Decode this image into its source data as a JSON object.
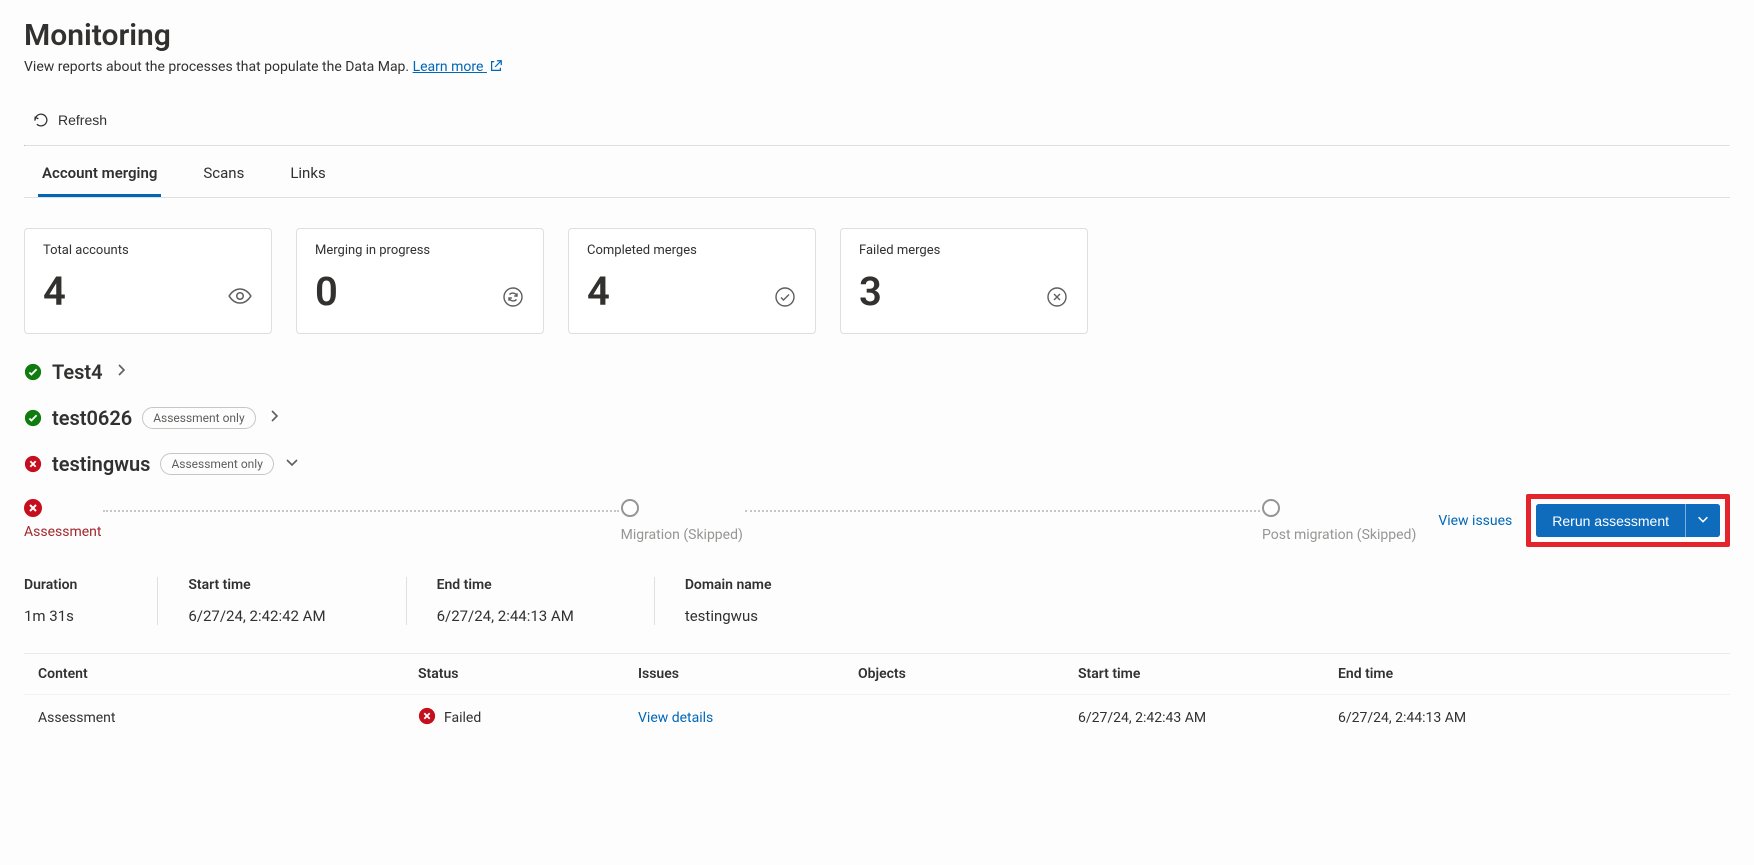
{
  "header": {
    "title": "Monitoring",
    "description_prefix": "View reports about the processes that populate the Data Map. ",
    "learn_more": "Learn more"
  },
  "toolbar": {
    "refresh": "Refresh"
  },
  "tabs": [
    {
      "label": "Account merging",
      "active": true
    },
    {
      "label": "Scans",
      "active": false
    },
    {
      "label": "Links",
      "active": false
    }
  ],
  "cards": [
    {
      "label": "Total accounts",
      "value": "4",
      "icon": "eye-icon"
    },
    {
      "label": "Merging in progress",
      "value": "0",
      "icon": "sync-icon"
    },
    {
      "label": "Completed merges",
      "value": "4",
      "icon": "check-circle-icon"
    },
    {
      "label": "Failed merges",
      "value": "3",
      "icon": "x-circle-icon"
    }
  ],
  "accounts": [
    {
      "status": "ok",
      "name": "Test4",
      "pill": "",
      "chevron": "right",
      "expanded": false
    },
    {
      "status": "ok",
      "name": "test0626",
      "pill": "Assessment only",
      "chevron": "right",
      "expanded": false
    },
    {
      "status": "fail",
      "name": "testingwus",
      "pill": "Assessment only",
      "chevron": "down",
      "expanded": true
    }
  ],
  "expanded": {
    "stages": [
      {
        "state": "fail",
        "label": "Assessment"
      },
      {
        "state": "skip",
        "label": "Migration (Skipped)"
      },
      {
        "state": "skip",
        "label": "Post migration (Skipped)"
      }
    ],
    "view_issues": "View issues",
    "rerun": "Rerun assessment",
    "meta": {
      "duration_k": "Duration",
      "duration_v": "1m 31s",
      "start_k": "Start time",
      "start_v": "6/27/24, 2:42:42 AM",
      "end_k": "End time",
      "end_v": "6/27/24, 2:44:13 AM",
      "domain_k": "Domain name",
      "domain_v": "testingwus"
    },
    "table": {
      "cols": [
        "Content",
        "Status",
        "Issues",
        "Objects",
        "Start time",
        "End time"
      ],
      "rows": [
        {
          "content": "Assessment",
          "status": "Failed",
          "issues": "View details",
          "objects": "",
          "start": "6/27/24, 2:42:43 AM",
          "end": "6/27/24, 2:44:13 AM"
        }
      ]
    }
  }
}
